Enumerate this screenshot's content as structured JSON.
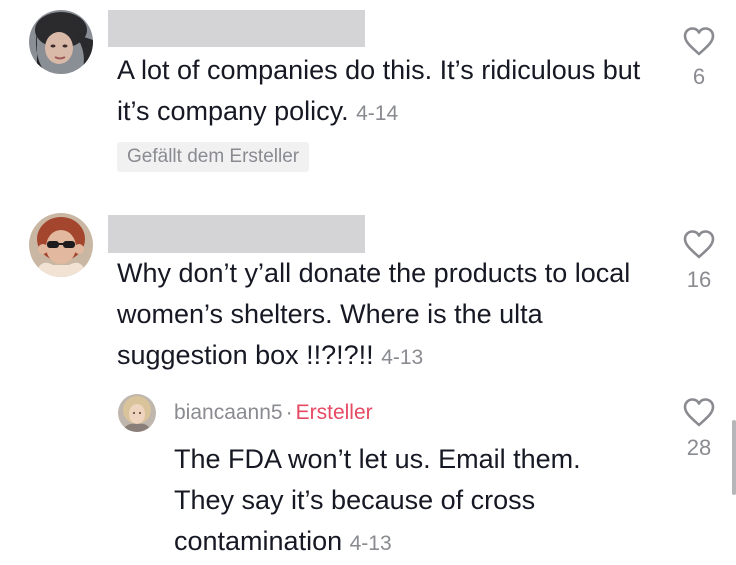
{
  "comments": [
    {
      "text": "A lot of companies do this. It’s ridiculous but it’s company policy.",
      "date": "4-14",
      "badge": "Gefällt dem Ersteller",
      "likes": "6"
    },
    {
      "text": "Why don’t y’all donate the products to local women’s shelters. Where is the ulta suggestion box !!?!?!!",
      "date": "4-13",
      "likes": "16",
      "reply": {
        "author": "biancaann5",
        "separator": "·",
        "creator_label": "Ersteller",
        "text": "The FDA won’t let us. Email them. They say it’s because of cross contamination",
        "date": "4-13",
        "likes": "28"
      }
    }
  ],
  "icons": {
    "like": "heart-outline-icon"
  },
  "colors": {
    "creator": "#e64a63",
    "muted": "#8a8b91",
    "redaction": "#d4d4d6"
  }
}
